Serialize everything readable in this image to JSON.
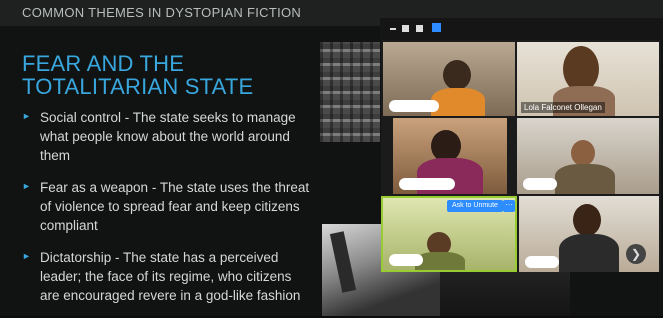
{
  "slide": {
    "header": "COMMON THEMES IN DYSTOPIAN FICTION",
    "title": "FEAR AND THE TOTALITARIAN STATE",
    "bullets": [
      {
        "text": "Social control - The state seeks to manage what people know about the world around them"
      },
      {
        "text": "Fear as a weapon - The state uses the threat of violence to spread fear and keep citizens compliant"
      },
      {
        "text": "Dictatorship - The state has a perceived leader; the face of its regime, who citizens are encouraged revere in a god-like fashion"
      }
    ]
  },
  "video_panel": {
    "participants": [
      {
        "name": ""
      },
      {
        "name": "Lola Falconet Ollegan"
      },
      {
        "name": ""
      },
      {
        "name": ""
      },
      {
        "name": ""
      },
      {
        "name": ""
      }
    ],
    "ask_to_unmute_label": "Ask to Unmute",
    "more_label": "···",
    "next_page_icon": "chevron-right-icon"
  },
  "colors": {
    "accent": "#39a7de",
    "active_speaker_border": "#99cc33",
    "button_blue": "#2d8cff"
  }
}
